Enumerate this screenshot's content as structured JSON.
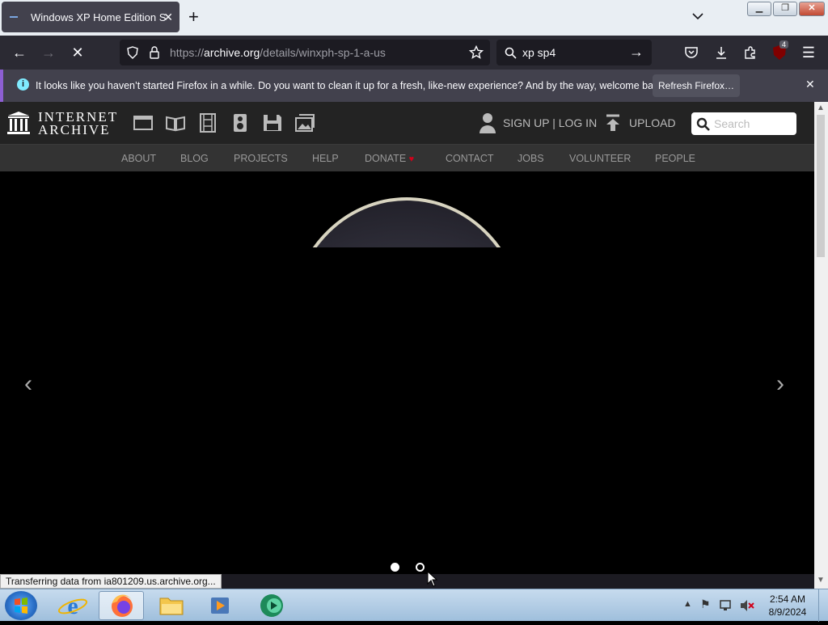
{
  "browser": {
    "tab_title": "Windows XP Home Edition Serv",
    "url_host": "archive.org",
    "url_prefix": "https://",
    "url_path": "/details/winxph-sp-1-a-us",
    "search_query": "xp sp4",
    "extensions_badge": "4"
  },
  "notification": {
    "message": "It looks like you haven’t started Firefox in a while. Do you want to clean it up for a fresh, like-new experience? And by the way, welcome back!",
    "button": "Refresh Firefox…"
  },
  "ia": {
    "logo_line1": "INTERNET",
    "logo_line2": "ARCHIVE",
    "signin": "SIGN UP | LOG IN",
    "upload": "UPLOAD",
    "search_placeholder": "Search",
    "nav": [
      "ABOUT",
      "BLOG",
      "PROJECTS",
      "HELP",
      "DONATE",
      "CONTACT",
      "JOBS",
      "VOLUNTEER",
      "PEOPLE"
    ]
  },
  "status_text": "Transferring data from ia801209.us.archive.org...",
  "taskbar": {
    "time": "2:54 AM",
    "date": "8/9/2024"
  }
}
